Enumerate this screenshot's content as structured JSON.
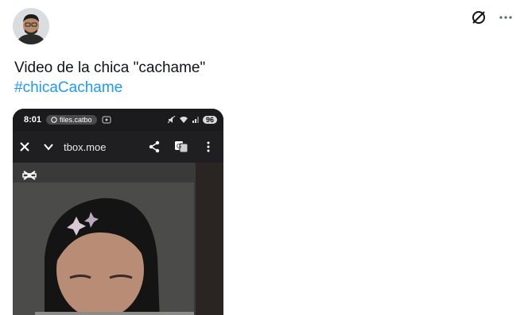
{
  "tweet": {
    "text": "Video de la chica \"cachame\"",
    "hashtag": "#chicaCachame"
  },
  "phone": {
    "time": "8:01",
    "pill_url": "files.catbo",
    "url": "tbox.moe",
    "battery": "96"
  },
  "icons": {
    "grok": "slash-circle-icon",
    "more": "more-dots-icon",
    "close": "close-icon",
    "chevron": "chevron-down-icon",
    "share": "share-icon",
    "translate": "translate-icon",
    "menu": "kebab-menu-icon",
    "capcut": "capcut-icon"
  },
  "colors": {
    "hashtag": "#1d9bf0",
    "text": "#0f1419"
  }
}
